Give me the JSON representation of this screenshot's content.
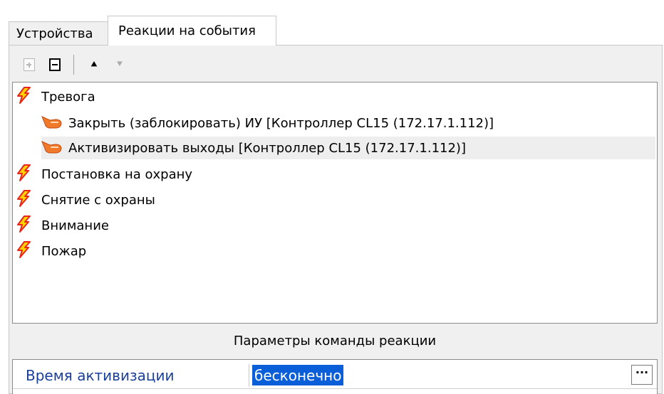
{
  "tabs": [
    {
      "label": "Устройства",
      "active": false
    },
    {
      "label": "Реакции на события",
      "active": true
    }
  ],
  "toolbar": {
    "add_icon": "add-box-icon",
    "remove_icon": "remove-box-icon",
    "move_up_icon": "move-up-icon",
    "move_down_icon": "move-down-icon",
    "move_up_glyph": "⯅",
    "move_down_glyph": "⯆"
  },
  "tree": {
    "events": [
      {
        "label": "Тревога",
        "icon": "lightning-icon",
        "reactions": [
          {
            "label": "Закрыть (заблокировать) ИУ [Контроллер CL15 (172.17.1.112)]",
            "icon": "hand-pointer-icon",
            "selected": false
          },
          {
            "label": "Активизировать выходы [Контроллер CL15 (172.17.1.112)]",
            "icon": "hand-pointer-icon",
            "selected": true
          }
        ]
      },
      {
        "label": "Постановка на охрану",
        "icon": "lightning-icon",
        "reactions": []
      },
      {
        "label": "Снятие с охраны",
        "icon": "lightning-icon",
        "reactions": []
      },
      {
        "label": "Внимание",
        "icon": "lightning-icon",
        "reactions": []
      },
      {
        "label": "Пожар",
        "icon": "lightning-icon",
        "reactions": []
      }
    ]
  },
  "params": {
    "caption": "Параметры команды реакции",
    "rows": [
      {
        "name": "Время активизации",
        "value": "бесконечно",
        "button": "···"
      }
    ]
  },
  "colors": {
    "lightning_red": "#e8261a",
    "lightning_yellow": "#ffd200",
    "hand_orange": "#f07a2a",
    "selection_blue": "#0a5fd8",
    "param_name_blue": "#1a3f9a"
  }
}
